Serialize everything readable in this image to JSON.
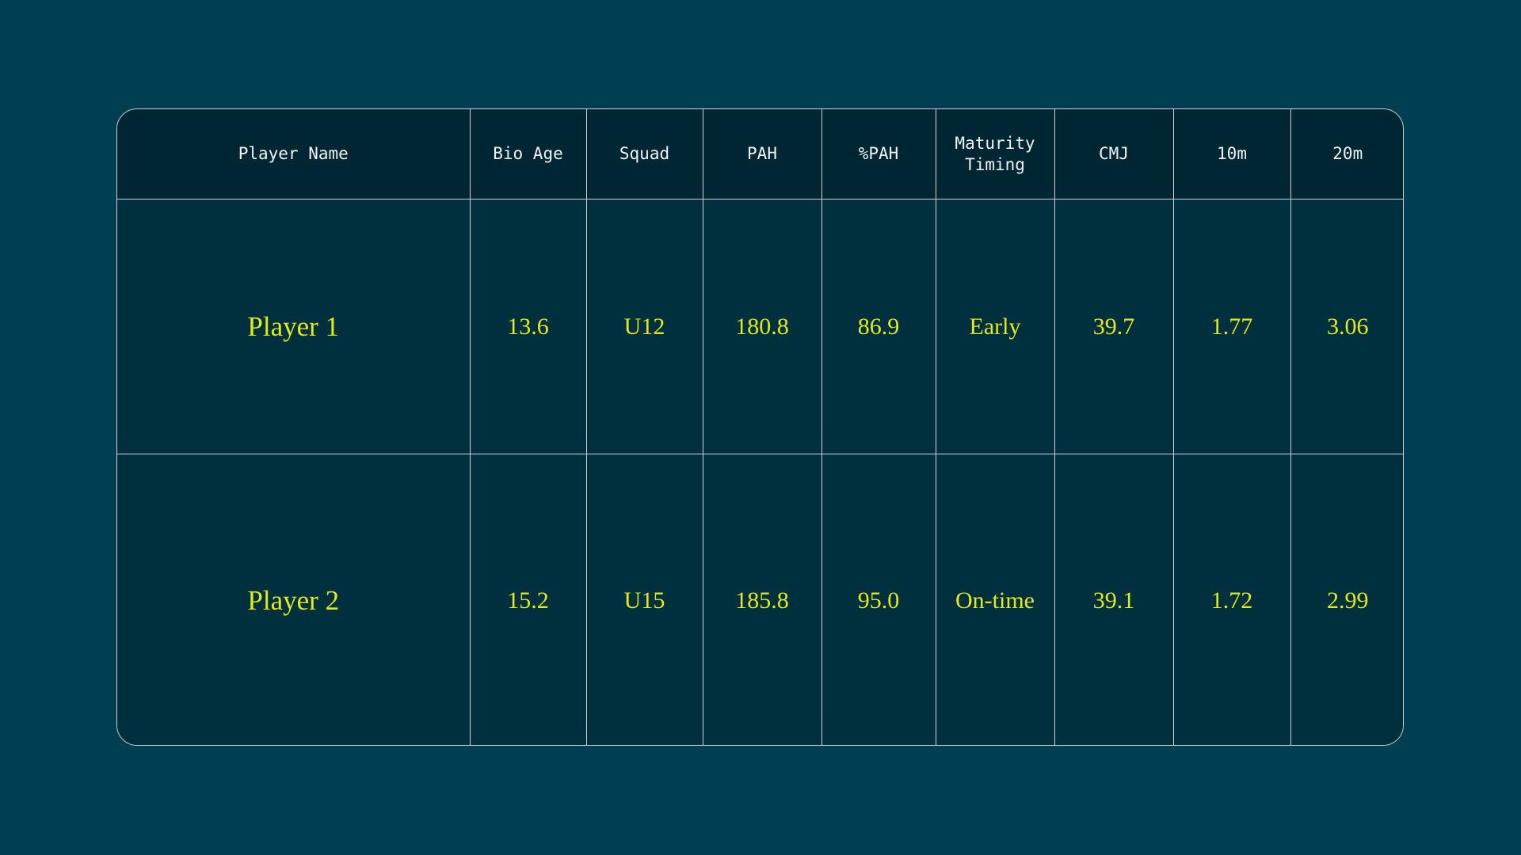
{
  "colors": {
    "page_background": "#003e51",
    "table_body": "#002f3e",
    "table_header": "#002634",
    "border": "#c9d2d6",
    "header_text": "#eef3f5",
    "value_text": "#e1e921"
  },
  "table": {
    "columns": [
      {
        "key": "player_name",
        "label": "Player Name"
      },
      {
        "key": "bio_age",
        "label": "Bio Age"
      },
      {
        "key": "squad",
        "label": "Squad"
      },
      {
        "key": "pah",
        "label": "PAH"
      },
      {
        "key": "pct_pah",
        "label": "%PAH"
      },
      {
        "key": "maturity_timing",
        "label": "Maturity\nTiming"
      },
      {
        "key": "cmj",
        "label": "CMJ"
      },
      {
        "key": "ten_m",
        "label": "10m"
      },
      {
        "key": "twenty_m",
        "label": "20m"
      }
    ],
    "rows": [
      {
        "player_name": "Player 1",
        "bio_age": "13.6",
        "squad": "U12",
        "pah": "180.8",
        "pct_pah": "86.9",
        "maturity_timing": "Early",
        "cmj": "39.7",
        "ten_m": "1.77",
        "twenty_m": "3.06"
      },
      {
        "player_name": "Player 2",
        "bio_age": "15.2",
        "squad": "U15",
        "pah": "185.8",
        "pct_pah": "95.0",
        "maturity_timing": "On-time",
        "cmj": "39.1",
        "ten_m": "1.72",
        "twenty_m": "2.99"
      }
    ]
  }
}
